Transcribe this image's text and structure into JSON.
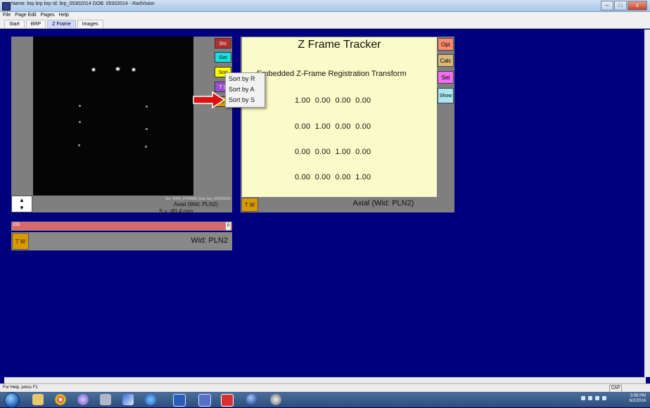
{
  "window": {
    "title": "Name: brp brp brp    Id: brp_05302014    DOB: 05302014 - RadVision",
    "controls": [
      "–",
      "□",
      "x"
    ]
  },
  "menu": {
    "items": [
      "File",
      "Page Edit",
      "Pages",
      "Help"
    ]
  },
  "tabs": [
    {
      "label": "Start"
    },
    {
      "label": "BRP"
    },
    {
      "label": "Z Frame",
      "active": true
    },
    {
      "label": "Images"
    }
  ],
  "viewer": {
    "side_buttons": [
      "Src",
      "Get",
      "Sort",
      "T S",
      "V"
    ],
    "series_info": "Ser: 0004_ZFRAME (Grp: brp_05302014)",
    "axial_label": "Axial (Wid: PLN2)",
    "slice_pos": "S = -80.4 mm",
    "updown": [
      "▲",
      "▼"
    ]
  },
  "sort_menu": {
    "items": [
      "Sort by R",
      "Sort by A",
      "Sort by S"
    ]
  },
  "slider": {
    "min_label": "255",
    "max_label": "0"
  },
  "wid_panel": {
    "tw_label": "T W",
    "wid_label": "Wid: PLN2"
  },
  "zframe": {
    "title": "Z Frame Tracker",
    "subtitle": "Embedded Z-Frame Registration Transform",
    "matrix": [
      "1.00  0.00  0.00  0.00",
      "0.00  1.00  0.00  0.00",
      "0.00  0.00  1.00  0.00",
      "0.00  0.00  0.00  1.00"
    ],
    "buttons": [
      "Opt",
      "Calc",
      "Set",
      "Show"
    ],
    "tw_label": "T W",
    "axial_label": "Axial (Wid: PLN2)"
  },
  "status": {
    "help_text": "For Help, press F1",
    "cap": "CAP"
  },
  "taskbar": {
    "time": "3:08 PM",
    "date": "6/2/2014"
  },
  "colors": {
    "background": "#00007f",
    "tracker_bg": "#fbfbc9",
    "slider": "#d96a6a",
    "tw_button": "#d99a00"
  }
}
